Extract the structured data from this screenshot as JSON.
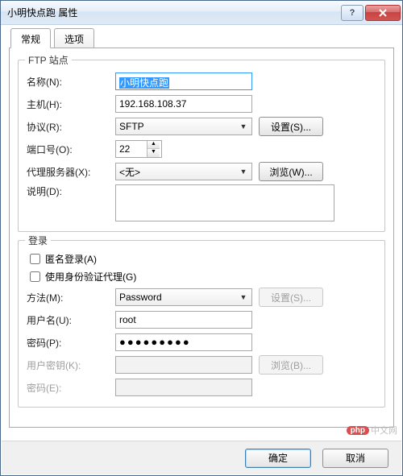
{
  "title": "小明快点跑 属性",
  "tabs": {
    "general": "常规",
    "options": "选项"
  },
  "ftp": {
    "legend": "FTP 站点",
    "name_label": "名称(N):",
    "name_value": "小明快点跑",
    "host_label": "主机(H):",
    "host_value": "192.168.108.37",
    "protocol_label": "协议(R):",
    "protocol_value": "SFTP",
    "settings_btn": "设置(S)...",
    "port_label": "端口号(O):",
    "port_value": "22",
    "proxy_label": "代理服务器(X):",
    "proxy_value": "<无>",
    "browse_btn": "浏览(W)...",
    "desc_label": "说明(D):",
    "desc_value": ""
  },
  "login": {
    "legend": "登录",
    "anon_label": "匿名登录(A)",
    "useauthproxy_label": "使用身份验证代理(G)",
    "method_label": "方法(M):",
    "method_value": "Password",
    "method_settings_btn": "设置(S)...",
    "user_label": "用户名(U):",
    "user_value": "root",
    "pw_label": "密码(P):",
    "pw_value": "●●●●●●●●●",
    "userkey_label": "用户密钥(K):",
    "userkey_value": "",
    "userkey_browse_btn": "浏览(B)...",
    "passphrase_label": "密码(E):",
    "passphrase_value": ""
  },
  "footer": {
    "ok": "确定",
    "cancel": "取消"
  },
  "watermark": {
    "php": "php",
    "text": "中文网"
  }
}
